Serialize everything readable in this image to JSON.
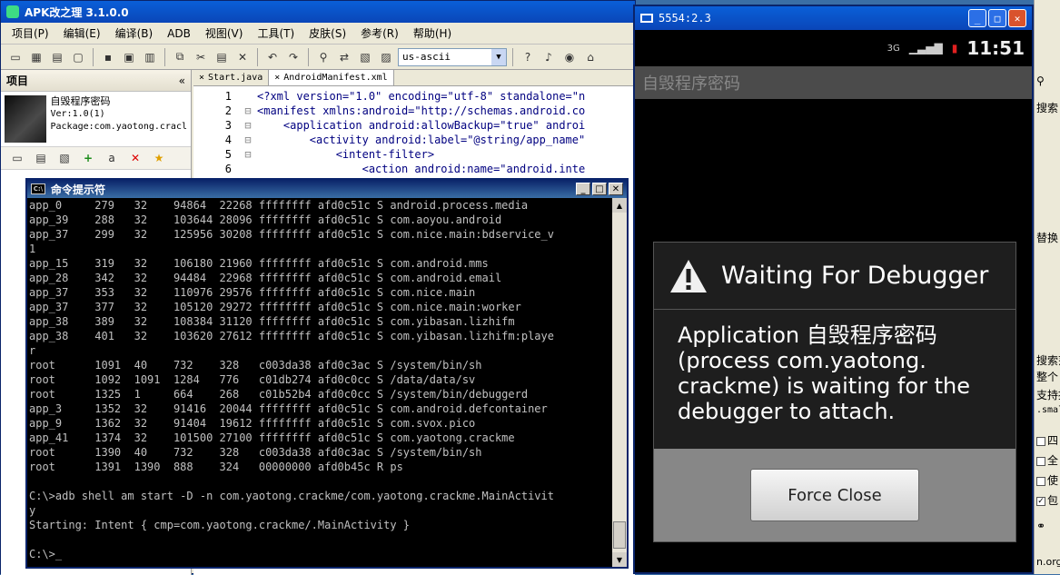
{
  "apk_window": {
    "title": "APK改之理 3.1.0.0",
    "menu": [
      "项目(P)",
      "编辑(E)",
      "编译(B)",
      "ADB",
      "视图(V)",
      "工具(T)",
      "皮肤(S)",
      "参考(R)",
      "帮助(H)"
    ],
    "encoding": "us-ascii"
  },
  "project_panel": {
    "header": "项目",
    "collapse_icon": "«",
    "app_name": "自毁程序密码",
    "version": "Ver:1.0(1)",
    "package": "Package:com.yaotong.cracl"
  },
  "editor": {
    "tabs": [
      "Start.java",
      "AndroidManifest.xml"
    ],
    "lines": [
      {
        "num": "1",
        "fold": "",
        "code": "<?xml version=\"1.0\" encoding=\"utf-8\" standalone=\"n"
      },
      {
        "num": "2",
        "fold": "⊟",
        "code": "<manifest xmlns:android=\"http://schemas.android.co"
      },
      {
        "num": "3",
        "fold": "⊟",
        "code": "    <application android:allowBackup=\"true\" androi"
      },
      {
        "num": "4",
        "fold": "⊟",
        "code": "        <activity android:label=\"@string/app_name\""
      },
      {
        "num": "5",
        "fold": "⊟",
        "code": "            <intent-filter>"
      },
      {
        "num": "6",
        "fold": "",
        "code": "                <action android:name=\"android.inte"
      }
    ]
  },
  "cmd_window": {
    "title": "命令提示符",
    "icon_text": "C:\\",
    "lines": [
      "app_0     279   32    94864  22268 ffffffff afd0c51c S android.process.media",
      "app_39    288   32    103644 28096 ffffffff afd0c51c S com.aoyou.android",
      "app_37    299   32    125956 30208 ffffffff afd0c51c S com.nice.main:bdservice_v",
      "1",
      "app_15    319   32    106180 21960 ffffffff afd0c51c S com.android.mms",
      "app_28    342   32    94484  22968 ffffffff afd0c51c S com.android.email",
      "app_37    353   32    110976 29576 ffffffff afd0c51c S com.nice.main",
      "app_37    377   32    105120 29272 ffffffff afd0c51c S com.nice.main:worker",
      "app_38    389   32    108384 31120 ffffffff afd0c51c S com.yibasan.lizhifm",
      "app_38    401   32    103620 27612 ffffffff afd0c51c S com.yibasan.lizhifm:playe",
      "r",
      "root      1091  40    732    328   c003da38 afd0c3ac S /system/bin/sh",
      "root      1092  1091  1284   776   c01db274 afd0c0cc S /data/data/sv",
      "root      1325  1     664    268   c01b52b4 afd0c0cc S /system/bin/debuggerd",
      "app_3     1352  32    91416  20044 ffffffff afd0c51c S com.android.defcontainer",
      "app_9     1362  32    91404  19612 ffffffff afd0c51c S com.svox.pico",
      "app_41    1374  32    101500 27100 ffffffff afd0c51c S com.yaotong.crackme",
      "root      1390  40    732    328   c003da38 afd0c3ac S /system/bin/sh",
      "root      1391  1390  888    324   00000000 afd0b45c R ps",
      "",
      "C:\\>adb shell am start -D -n com.yaotong.crackme/com.yaotong.crackme.MainActivit",
      "y",
      "Starting: Intent { cmp=com.yaotong.crackme/.MainActivity }",
      "",
      "C:\\>_"
    ]
  },
  "emulator": {
    "title": "5554:2.3",
    "time": "11:51",
    "network": "3G",
    "app_title": "自毁程序密码",
    "dialog_title": "Waiting For Debugger",
    "dialog_message": "Application 自毁程序密码 (process com.yaotong. crackme) is waiting for the debugger to attach.",
    "dialog_button": "Force Close"
  },
  "right_strip": {
    "items": [
      "搜索",
      "替换",
      "搜索范",
      "整个",
      "支持控",
      ".smal",
      "四",
      "全",
      "使",
      "包",
      "n.org"
    ]
  }
}
